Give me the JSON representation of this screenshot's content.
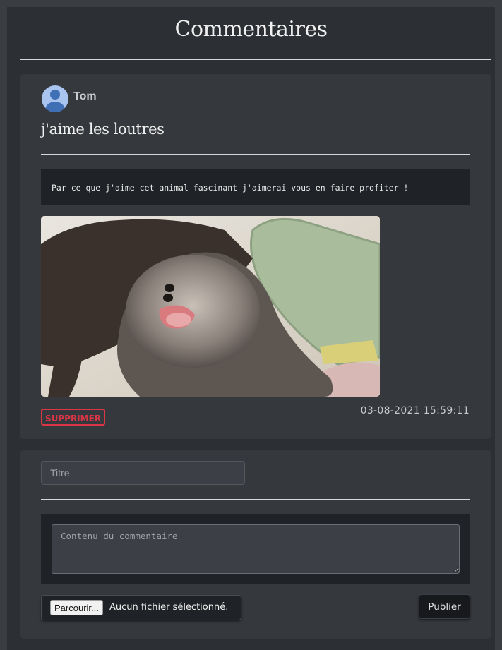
{
  "page": {
    "title": "Commentaires"
  },
  "post": {
    "author": "Tom",
    "avatar_icon": "user-avatar-icon",
    "title": "j'aime les loutres",
    "content": "Par ce que j'aime cet animal fascinant j'aimerai vous en faire profiter !",
    "image_subject": "otter photo",
    "delete_label": "SUPPRIMER",
    "timestamp": "03-08-2021 15:59:11"
  },
  "form": {
    "title_placeholder": "Titre",
    "content_placeholder": "Contenu du commentaire",
    "browse_label": "Parcourir...",
    "no_file_label": "Aucun fichier sélectionné.",
    "publish_label": "Publier"
  },
  "colors": {
    "background": "#2c2f33",
    "card": "#35383d",
    "danger": "#dc3545"
  }
}
